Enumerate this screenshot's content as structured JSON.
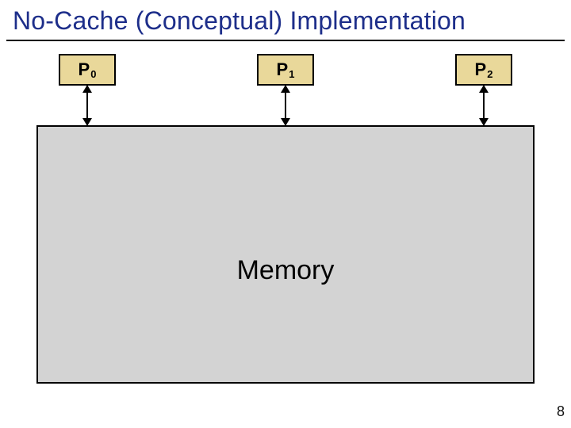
{
  "title": "No-Cache (Conceptual) Implementation",
  "processors": [
    {
      "label": "P",
      "sub": "0"
    },
    {
      "label": "P",
      "sub": "1"
    },
    {
      "label": "P",
      "sub": "2"
    }
  ],
  "memory_label": "Memory",
  "page_number": "8",
  "chart_data": {
    "type": "diagram",
    "nodes": [
      {
        "id": "P0",
        "kind": "processor",
        "label": "P0"
      },
      {
        "id": "P1",
        "kind": "processor",
        "label": "P1"
      },
      {
        "id": "P2",
        "kind": "processor",
        "label": "P2"
      },
      {
        "id": "MEM",
        "kind": "memory",
        "label": "Memory"
      }
    ],
    "edges": [
      {
        "from": "P0",
        "to": "MEM",
        "bidirectional": true
      },
      {
        "from": "P1",
        "to": "MEM",
        "bidirectional": true
      },
      {
        "from": "P2",
        "to": "MEM",
        "bidirectional": true
      }
    ]
  }
}
